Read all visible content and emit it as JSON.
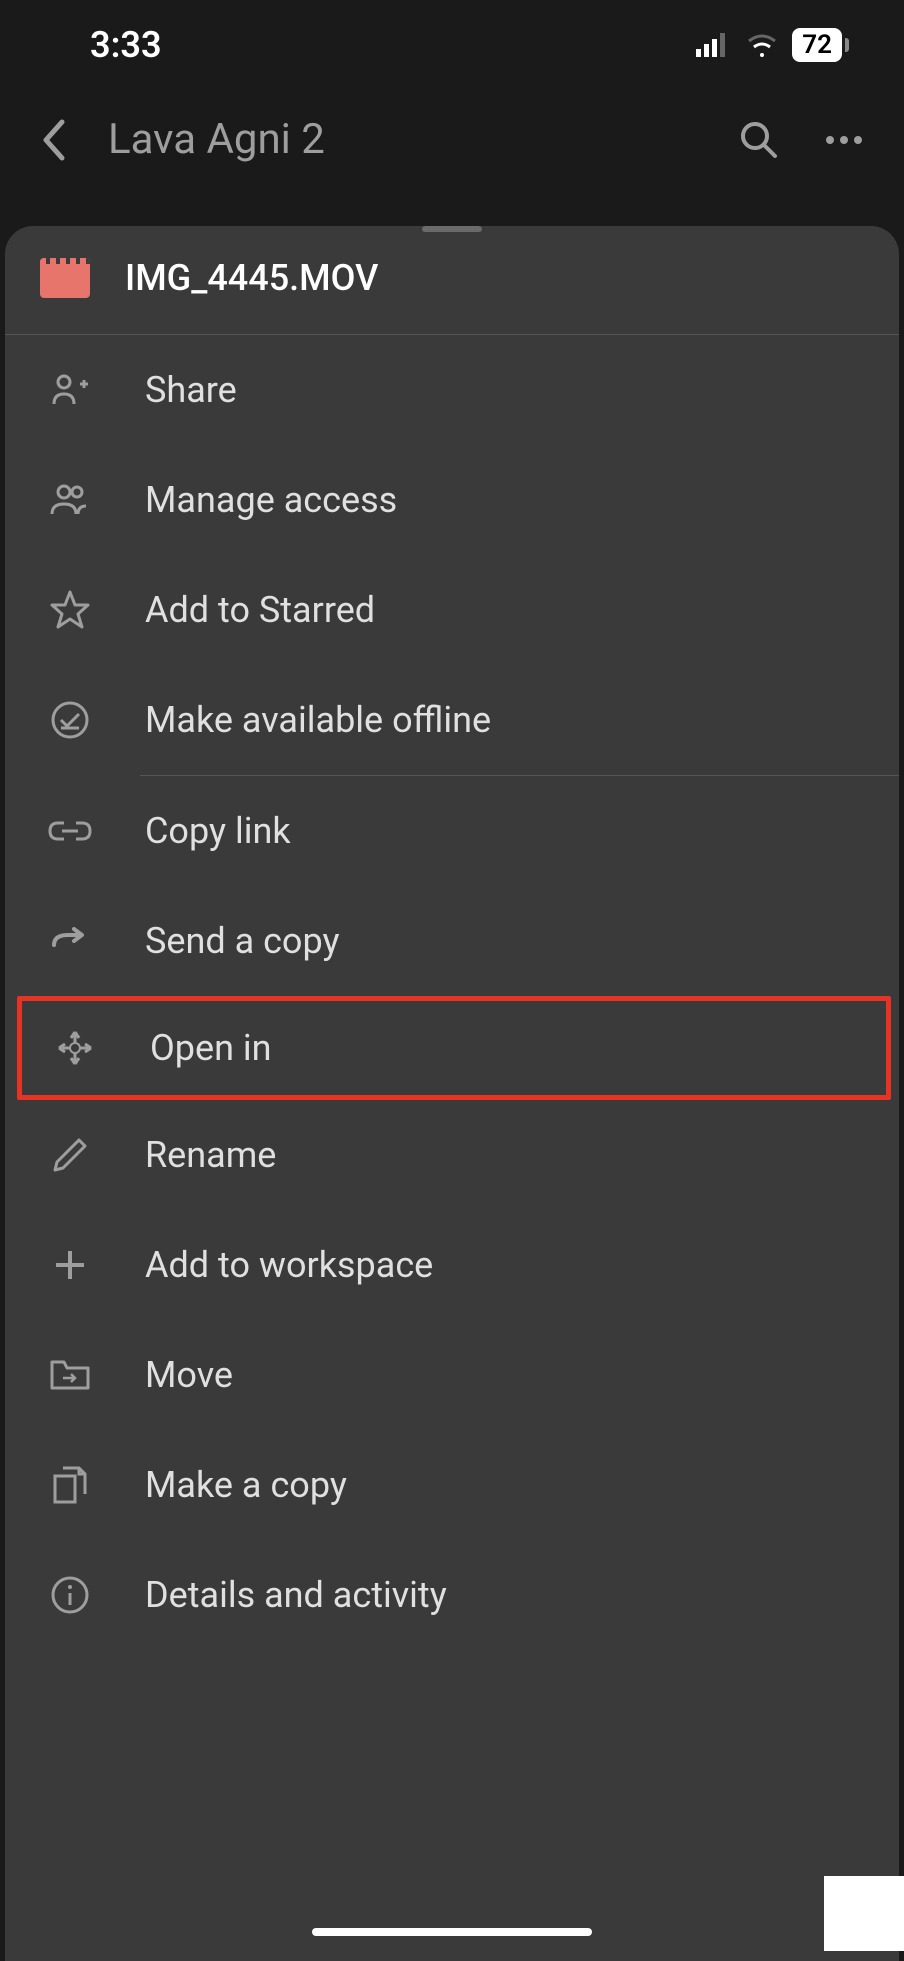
{
  "status": {
    "time": "3:33",
    "battery": "72"
  },
  "header": {
    "title": "Lava Agni 2"
  },
  "file": {
    "name": "IMG_4445.MOV"
  },
  "menu": {
    "share": "Share",
    "manage_access": "Manage access",
    "starred": "Add to Starred",
    "offline": "Make available offline",
    "copy_link": "Copy link",
    "send_copy": "Send a copy",
    "open_in": "Open in",
    "rename": "Rename",
    "add_workspace": "Add to workspace",
    "move": "Move",
    "make_copy": "Make a copy",
    "details": "Details and activity"
  }
}
